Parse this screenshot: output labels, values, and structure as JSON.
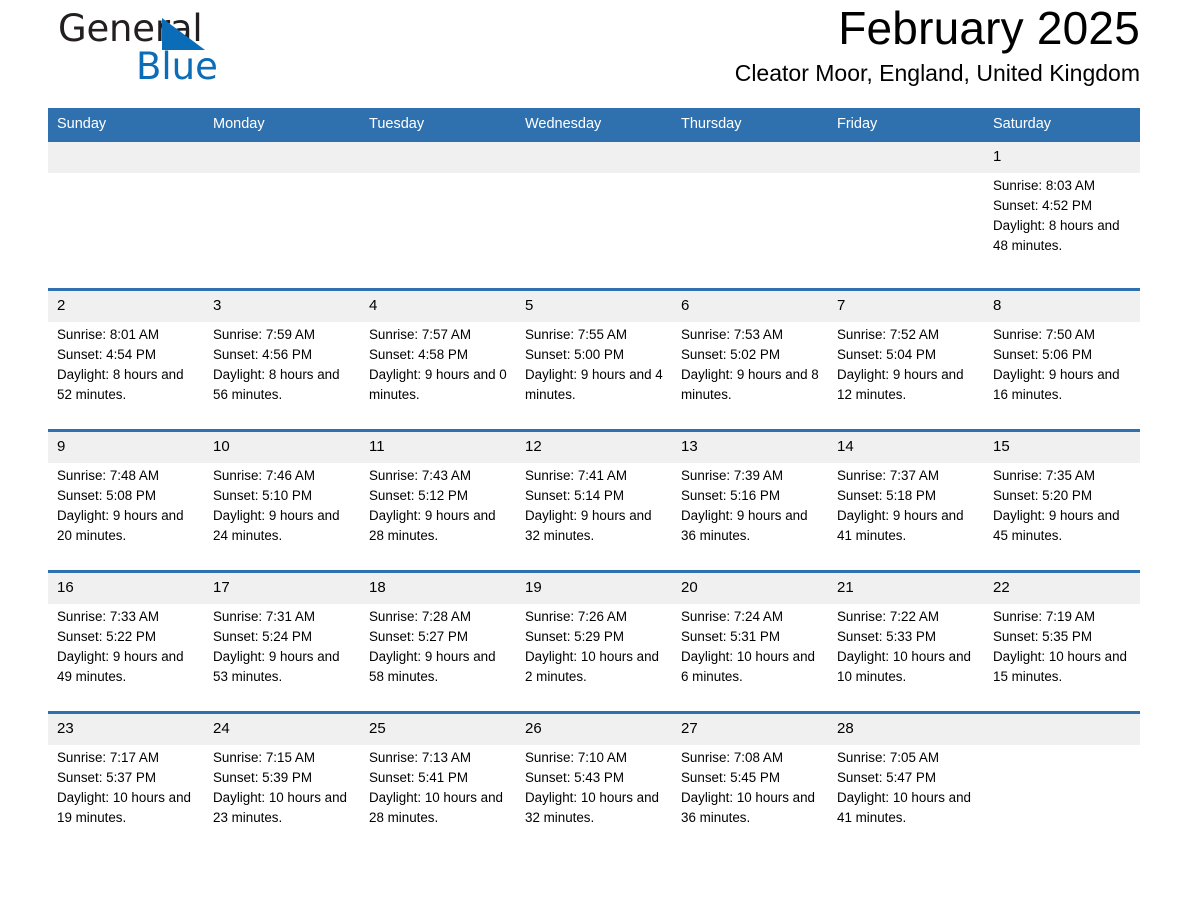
{
  "brand": {
    "logo_top": "General",
    "logo_bottom": "Blue",
    "logo_triangle": "triangle-icon",
    "accent_blue": "#2f71ae",
    "logo_blue": "#0b6cb7",
    "header_band": "#2f71ae",
    "daynum_band": "#f0f0f0"
  },
  "header": {
    "title": "February 2025",
    "subtitle": "Cleator Moor, England, United Kingdom"
  },
  "weekday_headers": [
    "Sunday",
    "Monday",
    "Tuesday",
    "Wednesday",
    "Thursday",
    "Friday",
    "Saturday"
  ],
  "weeks": [
    {
      "days": [
        {
          "date": "",
          "lines": []
        },
        {
          "date": "",
          "lines": []
        },
        {
          "date": "",
          "lines": []
        },
        {
          "date": "",
          "lines": []
        },
        {
          "date": "",
          "lines": []
        },
        {
          "date": "",
          "lines": []
        },
        {
          "date": "1",
          "sunrise": "Sunrise: 8:03 AM",
          "sunset": "Sunset: 4:52 PM",
          "daylight": "Daylight: 8 hours and 48 minutes."
        }
      ]
    },
    {
      "days": [
        {
          "date": "2",
          "sunrise": "Sunrise: 8:01 AM",
          "sunset": "Sunset: 4:54 PM",
          "daylight": "Daylight: 8 hours and 52 minutes."
        },
        {
          "date": "3",
          "sunrise": "Sunrise: 7:59 AM",
          "sunset": "Sunset: 4:56 PM",
          "daylight": "Daylight: 8 hours and 56 minutes."
        },
        {
          "date": "4",
          "sunrise": "Sunrise: 7:57 AM",
          "sunset": "Sunset: 4:58 PM",
          "daylight": "Daylight: 9 hours and 0 minutes."
        },
        {
          "date": "5",
          "sunrise": "Sunrise: 7:55 AM",
          "sunset": "Sunset: 5:00 PM",
          "daylight": "Daylight: 9 hours and 4 minutes."
        },
        {
          "date": "6",
          "sunrise": "Sunrise: 7:53 AM",
          "sunset": "Sunset: 5:02 PM",
          "daylight": "Daylight: 9 hours and 8 minutes."
        },
        {
          "date": "7",
          "sunrise": "Sunrise: 7:52 AM",
          "sunset": "Sunset: 5:04 PM",
          "daylight": "Daylight: 9 hours and 12 minutes."
        },
        {
          "date": "8",
          "sunrise": "Sunrise: 7:50 AM",
          "sunset": "Sunset: 5:06 PM",
          "daylight": "Daylight: 9 hours and 16 minutes."
        }
      ]
    },
    {
      "days": [
        {
          "date": "9",
          "sunrise": "Sunrise: 7:48 AM",
          "sunset": "Sunset: 5:08 PM",
          "daylight": "Daylight: 9 hours and 20 minutes."
        },
        {
          "date": "10",
          "sunrise": "Sunrise: 7:46 AM",
          "sunset": "Sunset: 5:10 PM",
          "daylight": "Daylight: 9 hours and 24 minutes."
        },
        {
          "date": "11",
          "sunrise": "Sunrise: 7:43 AM",
          "sunset": "Sunset: 5:12 PM",
          "daylight": "Daylight: 9 hours and 28 minutes."
        },
        {
          "date": "12",
          "sunrise": "Sunrise: 7:41 AM",
          "sunset": "Sunset: 5:14 PM",
          "daylight": "Daylight: 9 hours and 32 minutes."
        },
        {
          "date": "13",
          "sunrise": "Sunrise: 7:39 AM",
          "sunset": "Sunset: 5:16 PM",
          "daylight": "Daylight: 9 hours and 36 minutes."
        },
        {
          "date": "14",
          "sunrise": "Sunrise: 7:37 AM",
          "sunset": "Sunset: 5:18 PM",
          "daylight": "Daylight: 9 hours and 41 minutes."
        },
        {
          "date": "15",
          "sunrise": "Sunrise: 7:35 AM",
          "sunset": "Sunset: 5:20 PM",
          "daylight": "Daylight: 9 hours and 45 minutes."
        }
      ]
    },
    {
      "days": [
        {
          "date": "16",
          "sunrise": "Sunrise: 7:33 AM",
          "sunset": "Sunset: 5:22 PM",
          "daylight": "Daylight: 9 hours and 49 minutes."
        },
        {
          "date": "17",
          "sunrise": "Sunrise: 7:31 AM",
          "sunset": "Sunset: 5:24 PM",
          "daylight": "Daylight: 9 hours and 53 minutes."
        },
        {
          "date": "18",
          "sunrise": "Sunrise: 7:28 AM",
          "sunset": "Sunset: 5:27 PM",
          "daylight": "Daylight: 9 hours and 58 minutes."
        },
        {
          "date": "19",
          "sunrise": "Sunrise: 7:26 AM",
          "sunset": "Sunset: 5:29 PM",
          "daylight": "Daylight: 10 hours and 2 minutes."
        },
        {
          "date": "20",
          "sunrise": "Sunrise: 7:24 AM",
          "sunset": "Sunset: 5:31 PM",
          "daylight": "Daylight: 10 hours and 6 minutes."
        },
        {
          "date": "21",
          "sunrise": "Sunrise: 7:22 AM",
          "sunset": "Sunset: 5:33 PM",
          "daylight": "Daylight: 10 hours and 10 minutes."
        },
        {
          "date": "22",
          "sunrise": "Sunrise: 7:19 AM",
          "sunset": "Sunset: 5:35 PM",
          "daylight": "Daylight: 10 hours and 15 minutes."
        }
      ]
    },
    {
      "days": [
        {
          "date": "23",
          "sunrise": "Sunrise: 7:17 AM",
          "sunset": "Sunset: 5:37 PM",
          "daylight": "Daylight: 10 hours and 19 minutes."
        },
        {
          "date": "24",
          "sunrise": "Sunrise: 7:15 AM",
          "sunset": "Sunset: 5:39 PM",
          "daylight": "Daylight: 10 hours and 23 minutes."
        },
        {
          "date": "25",
          "sunrise": "Sunrise: 7:13 AM",
          "sunset": "Sunset: 5:41 PM",
          "daylight": "Daylight: 10 hours and 28 minutes."
        },
        {
          "date": "26",
          "sunrise": "Sunrise: 7:10 AM",
          "sunset": "Sunset: 5:43 PM",
          "daylight": "Daylight: 10 hours and 32 minutes."
        },
        {
          "date": "27",
          "sunrise": "Sunrise: 7:08 AM",
          "sunset": "Sunset: 5:45 PM",
          "daylight": "Daylight: 10 hours and 36 minutes."
        },
        {
          "date": "28",
          "sunrise": "Sunrise: 7:05 AM",
          "sunset": "Sunset: 5:47 PM",
          "daylight": "Daylight: 10 hours and 41 minutes."
        },
        {
          "date": "",
          "lines": []
        }
      ]
    }
  ]
}
